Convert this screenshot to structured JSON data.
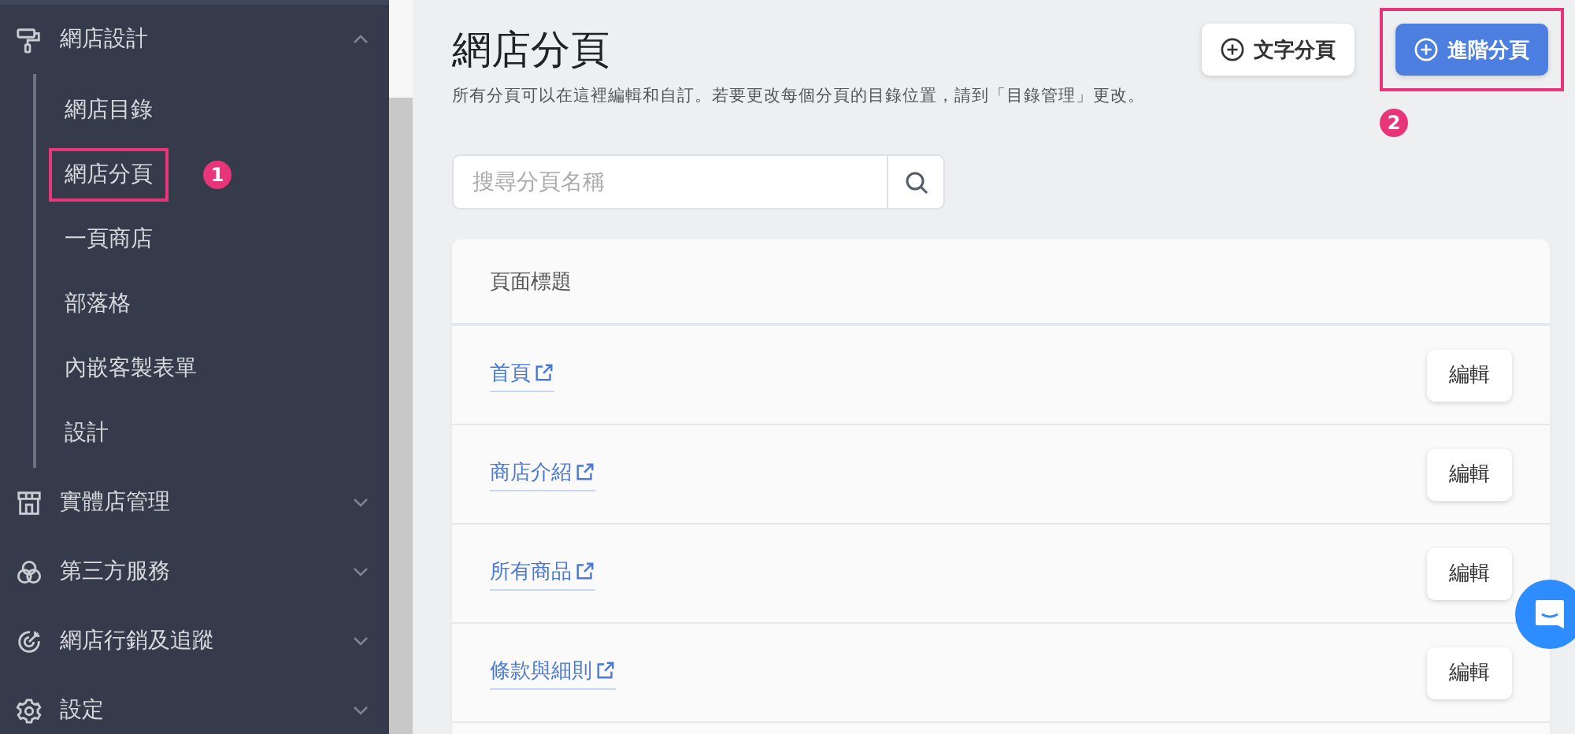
{
  "sidebar": {
    "groups": [
      {
        "label": "網店設計",
        "expanded": true,
        "children": [
          {
            "label": "網店目錄",
            "selected": false
          },
          {
            "label": "網店分頁",
            "selected": true,
            "callout": "1"
          },
          {
            "label": "一頁商店",
            "selected": false
          },
          {
            "label": "部落格",
            "selected": false
          },
          {
            "label": "內嵌客製表單",
            "selected": false
          },
          {
            "label": "設計",
            "selected": false
          }
        ]
      },
      {
        "label": "實體店管理",
        "expanded": false
      },
      {
        "label": "第三方服務",
        "expanded": false
      },
      {
        "label": "網店行銷及追蹤",
        "expanded": false
      },
      {
        "label": "設定",
        "expanded": false
      }
    ]
  },
  "page": {
    "title": "網店分頁",
    "description": "所有分頁可以在這裡編輯和自訂。若要更改每個分頁的目錄位置，請到「目錄管理」更改。",
    "buttons": [
      {
        "label": "文字分頁",
        "kind": "secondary",
        "highlighted": false
      },
      {
        "label": "進階分頁",
        "kind": "primary",
        "highlighted": true,
        "callout": "2"
      }
    ],
    "search": {
      "placeholder": "搜尋分頁名稱"
    },
    "table": {
      "columns": [
        "頁面標題"
      ],
      "rows": [
        {
          "title": "首頁",
          "action": "編輯"
        },
        {
          "title": "商店介紹",
          "action": "編輯"
        },
        {
          "title": "所有商品",
          "action": "編輯"
        },
        {
          "title": "條款與細則",
          "action": "編輯"
        }
      ]
    }
  }
}
